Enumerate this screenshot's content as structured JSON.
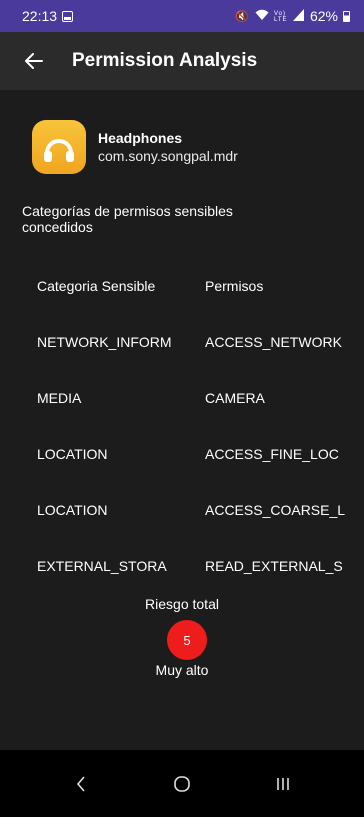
{
  "status_bar": {
    "time": "22:13",
    "icons": [
      "notification-icon",
      "mute-icon",
      "wifi-icon",
      "volte-icon",
      "signal-icon",
      "battery-icon"
    ],
    "battery": "62%"
  },
  "app_bar": {
    "title": "Permission Analysis",
    "back_icon": "arrow-back-icon"
  },
  "app": {
    "name": "Headphones",
    "package": "com.sony.songpal.mdr",
    "icon": "headphones-icon",
    "icon_color": "#f5b52a"
  },
  "section": {
    "title": "Categorías de permisos sensibles\n concedidos"
  },
  "table": {
    "headers": [
      "Categoria Sensible",
      "Permisos"
    ],
    "rows": [
      [
        "NETWORK_INFORM",
        "ACCESS_NETWORK"
      ],
      [
        "MEDIA",
        "CAMERA"
      ],
      [
        "LOCATION",
        "ACCESS_FINE_LOC"
      ],
      [
        "LOCATION",
        "ACCESS_COARSE_L"
      ],
      [
        "EXTERNAL_STORA",
        "READ_EXTERNAL_S"
      ]
    ]
  },
  "risk": {
    "label": "Riesgo total",
    "score": "5",
    "level": "Muy alto",
    "badge_color": "#ef1c1c"
  },
  "nav_bar": {
    "buttons": [
      "back-nav-icon",
      "home-nav-icon",
      "recents-nav-icon"
    ]
  },
  "colors": {
    "status_bar": "#4a3a9c",
    "app_bar": "#2b2b2b",
    "background": "#1c1c1c"
  }
}
